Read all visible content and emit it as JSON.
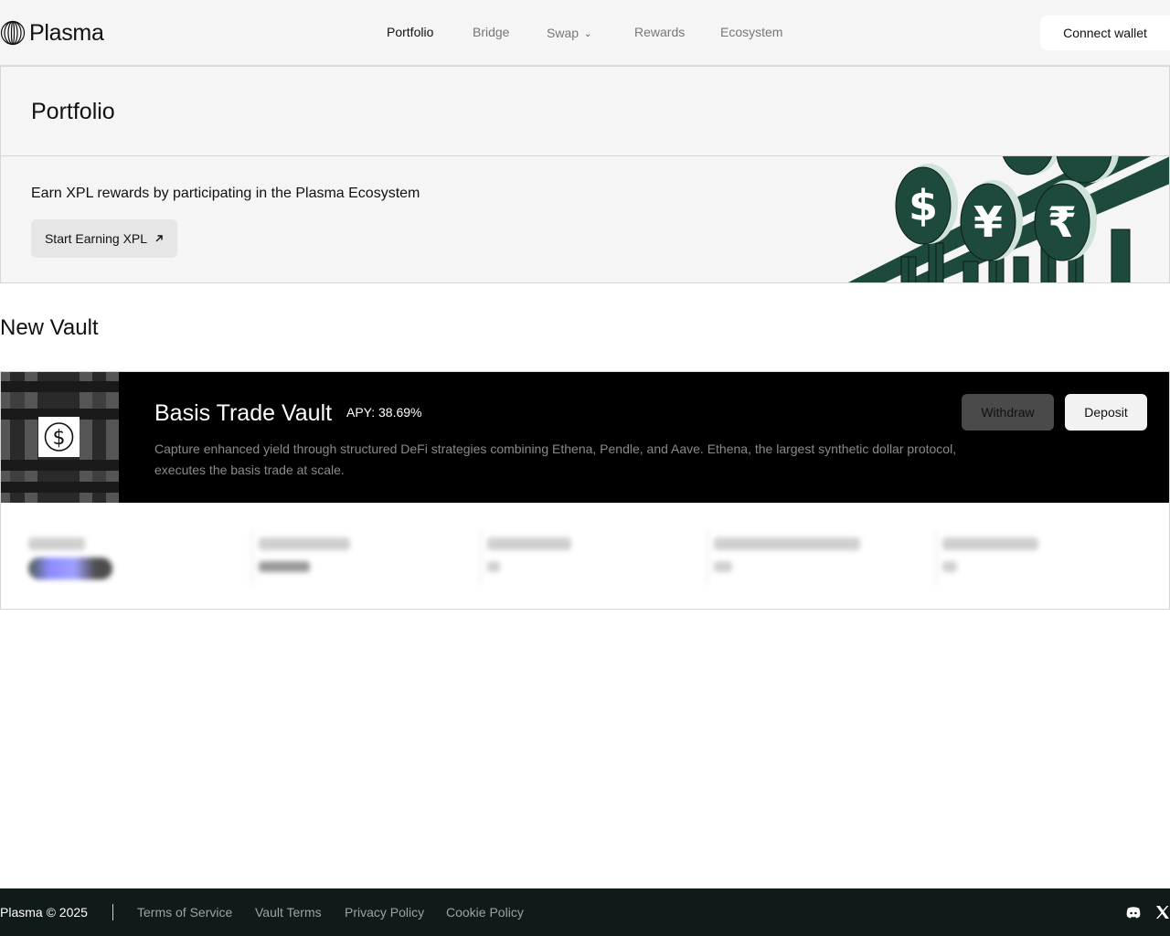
{
  "header": {
    "logo_text": "Plasma",
    "nav": [
      {
        "label": "Portfolio",
        "active": true
      },
      {
        "label": "Bridge",
        "active": false
      },
      {
        "label": "Swap",
        "active": false,
        "has_dropdown": true
      },
      {
        "label": "Rewards",
        "active": false
      },
      {
        "label": "Ecosystem",
        "active": false
      }
    ],
    "connect_label": "Connect wallet"
  },
  "portfolio": {
    "title": "Portfolio",
    "earn_text": "Earn XPL rewards by participating in the Plasma Ecosystem",
    "earn_button": "Start Earning XPL",
    "earn_button_icon": "arrow-up-right-icon",
    "art_symbols": [
      "$",
      "¥",
      "₹"
    ]
  },
  "new_vault": {
    "section_title": "New Vault",
    "vault": {
      "name": "Basis Trade Vault",
      "apy": "APY: 38.69%",
      "description": "Capture enhanced yield through structured DeFi strategies combining Ethena, Pendle, and Aave. Ethena, the largest synthetic dollar protocol, executes the basis trade at scale.",
      "withdraw_label": "Withdraw",
      "deposit_label": "Deposit",
      "thumb_icon": "dollar-coin-icon"
    }
  },
  "footer": {
    "copyright": "Plasma © 2025",
    "links": [
      "Terms of Service",
      "Vault Terms",
      "Privacy Policy",
      "Cookie Policy"
    ],
    "social": [
      "discord-icon",
      "x-icon"
    ]
  },
  "colors": {
    "brand_green": "#1e4a3d",
    "footer_bg": "#0f1b19",
    "banner_bg": "#000000",
    "page_bg": "#f5f5f5"
  }
}
